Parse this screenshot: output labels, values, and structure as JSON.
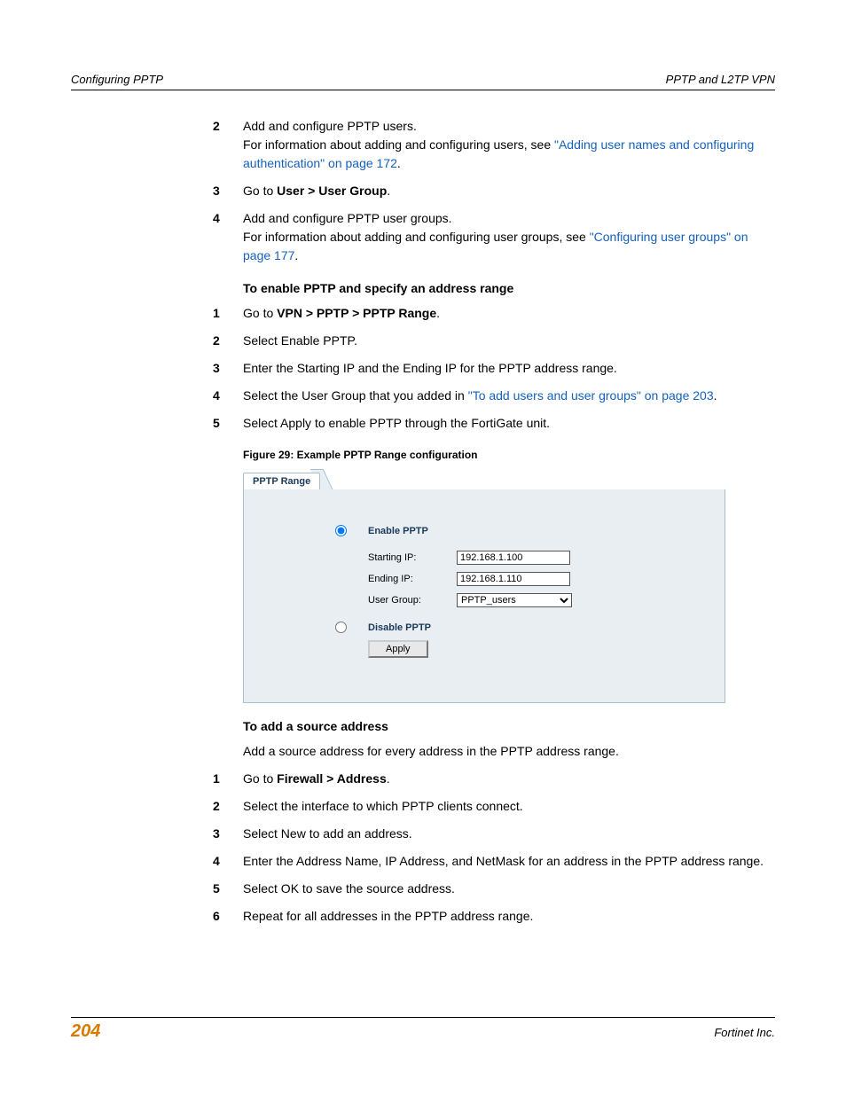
{
  "header": {
    "left": "Configuring PPTP",
    "right": "PPTP and L2TP VPN"
  },
  "top_steps": [
    {
      "num": "2",
      "lines": [
        "Add and configure PPTP users.",
        "For information about adding and configuring users, see ",
        {
          "link": "\"Adding user names and configuring authentication\" on page 172"
        },
        "."
      ]
    },
    {
      "num": "3",
      "lines": [
        "Go to ",
        {
          "bold": "User > User Group"
        },
        "."
      ]
    },
    {
      "num": "4",
      "lines": [
        "Add and configure PPTP user groups.",
        "For information about adding and configuring user groups, see ",
        {
          "link": "\"Configuring user groups\" on page 177"
        },
        "."
      ]
    }
  ],
  "sub1_title": "To enable PPTP and specify an address range",
  "sub1_steps": [
    {
      "num": "1",
      "lines": [
        "Go to ",
        {
          "bold": "VPN > PPTP > PPTP Range"
        },
        "."
      ]
    },
    {
      "num": "2",
      "lines": [
        "Select Enable PPTP."
      ]
    },
    {
      "num": "3",
      "lines": [
        "Enter the Starting IP and the Ending IP for the PPTP address range."
      ]
    },
    {
      "num": "4",
      "lines": [
        "Select the User Group that you added in ",
        {
          "link": "\"To add users and user groups\" on page 203"
        },
        "."
      ]
    },
    {
      "num": "5",
      "lines": [
        "Select Apply to enable PPTP through the FortiGate unit."
      ]
    }
  ],
  "figure_caption": "Figure 29: Example PPTP Range configuration",
  "figure": {
    "tab": "PPTP Range",
    "enable_label": "Enable PPTP",
    "starting_ip_label": "Starting IP:",
    "starting_ip_value": "192.168.1.100",
    "ending_ip_label": "Ending IP:",
    "ending_ip_value": "192.168.1.110",
    "user_group_label": "User Group:",
    "user_group_value": "PPTP_users",
    "disable_label": "Disable PPTP",
    "apply": "Apply"
  },
  "sub2_title": "To add a source address",
  "sub2_intro": "Add a source address for every address in the PPTP address range.",
  "sub2_steps": [
    {
      "num": "1",
      "lines": [
        "Go to ",
        {
          "bold": "Firewall > Address"
        },
        "."
      ]
    },
    {
      "num": "2",
      "lines": [
        "Select the interface to which PPTP clients connect."
      ]
    },
    {
      "num": "3",
      "lines": [
        "Select New to add an address."
      ]
    },
    {
      "num": "4",
      "lines": [
        "Enter the Address Name, IP Address, and NetMask for an address in the PPTP address range."
      ]
    },
    {
      "num": "5",
      "lines": [
        "Select OK to save the source address."
      ]
    },
    {
      "num": "6",
      "lines": [
        "Repeat for all addresses in the PPTP address range."
      ]
    }
  ],
  "footer": {
    "page": "204",
    "right": "Fortinet Inc."
  }
}
